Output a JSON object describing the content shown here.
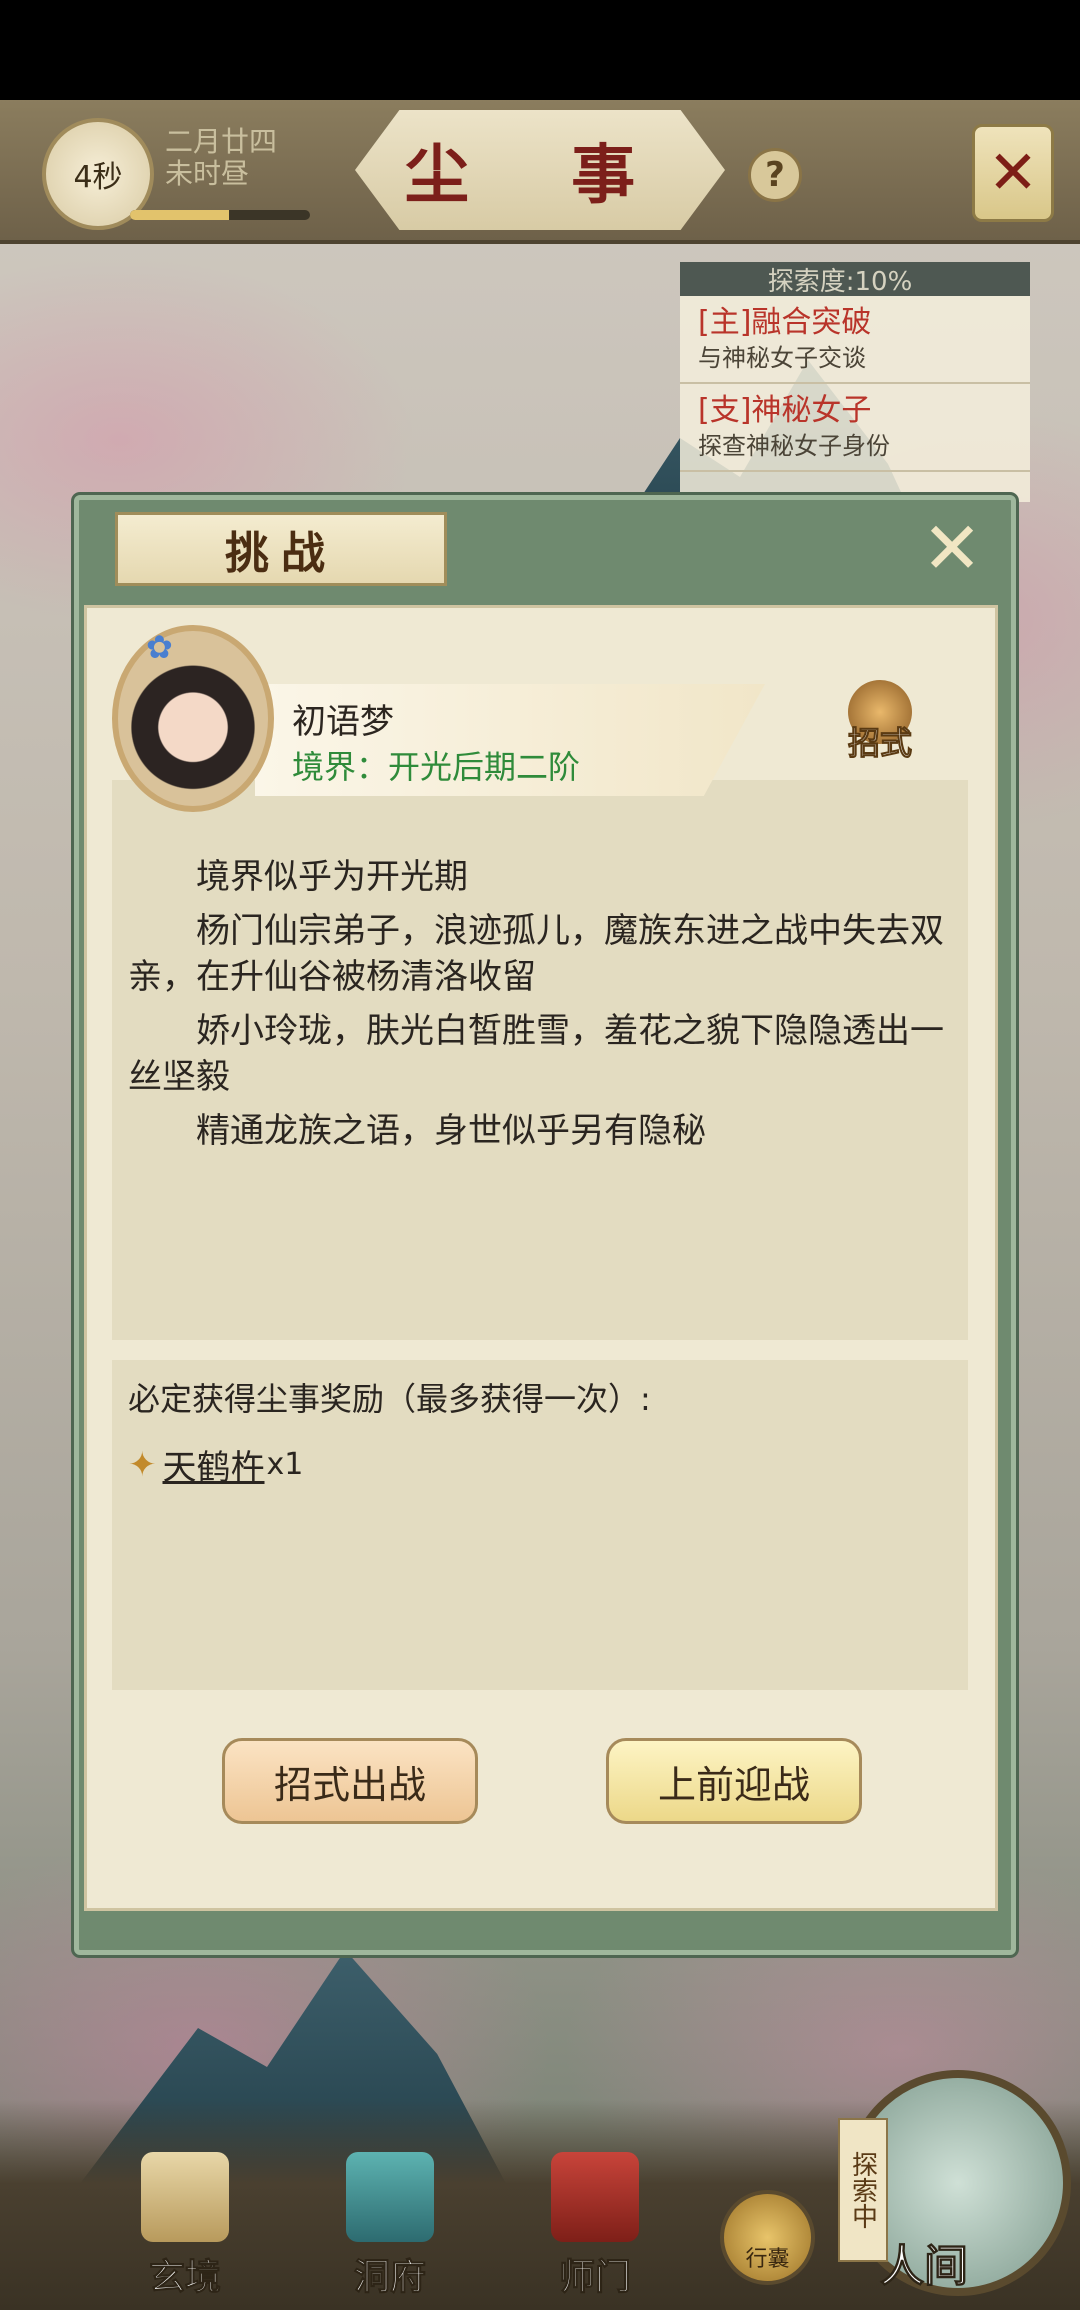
{
  "header": {
    "timer": "4秒",
    "date_line1": "二月廿四",
    "date_line2": "未时昼",
    "time_progress": 0.55,
    "title": "尘 事",
    "help": "?",
    "close": "✕"
  },
  "quest_panel": {
    "explore_label": "探索度:10%",
    "items": [
      {
        "title": "[主]融合突破",
        "sub": "与神秘女子交谈"
      },
      {
        "title": "[支]神秘女子",
        "sub": "探查神秘女子身份"
      }
    ]
  },
  "dialog": {
    "tab_title": "挑战",
    "close": "✕",
    "character": {
      "name": "初语梦",
      "realm": "境界：开光后期二阶"
    },
    "moves_label": "招式",
    "description": [
      "境界似乎为开光期",
      "杨门仙宗弟子，浪迹孤儿，魔族东进之战中失去双亲，在升仙谷被杨清洛收留",
      "娇小玲珑，肤光白皙胜雪，羞花之貌下隐隐透出一丝坚毅",
      "精通龙族之语，身世似乎另有隐秘"
    ],
    "reward_title": "必定获得尘事奖励（最多获得一次）:",
    "reward_item_name": "天鹤杵",
    "reward_item_qty": "x1",
    "btn_moves": "招式出战",
    "btn_fight": "上前迎战"
  },
  "bottom_nav": {
    "items": [
      "玄境",
      "洞府",
      "师门"
    ],
    "bag": "行囊",
    "exploring": "探索中",
    "renjian": "人间"
  }
}
